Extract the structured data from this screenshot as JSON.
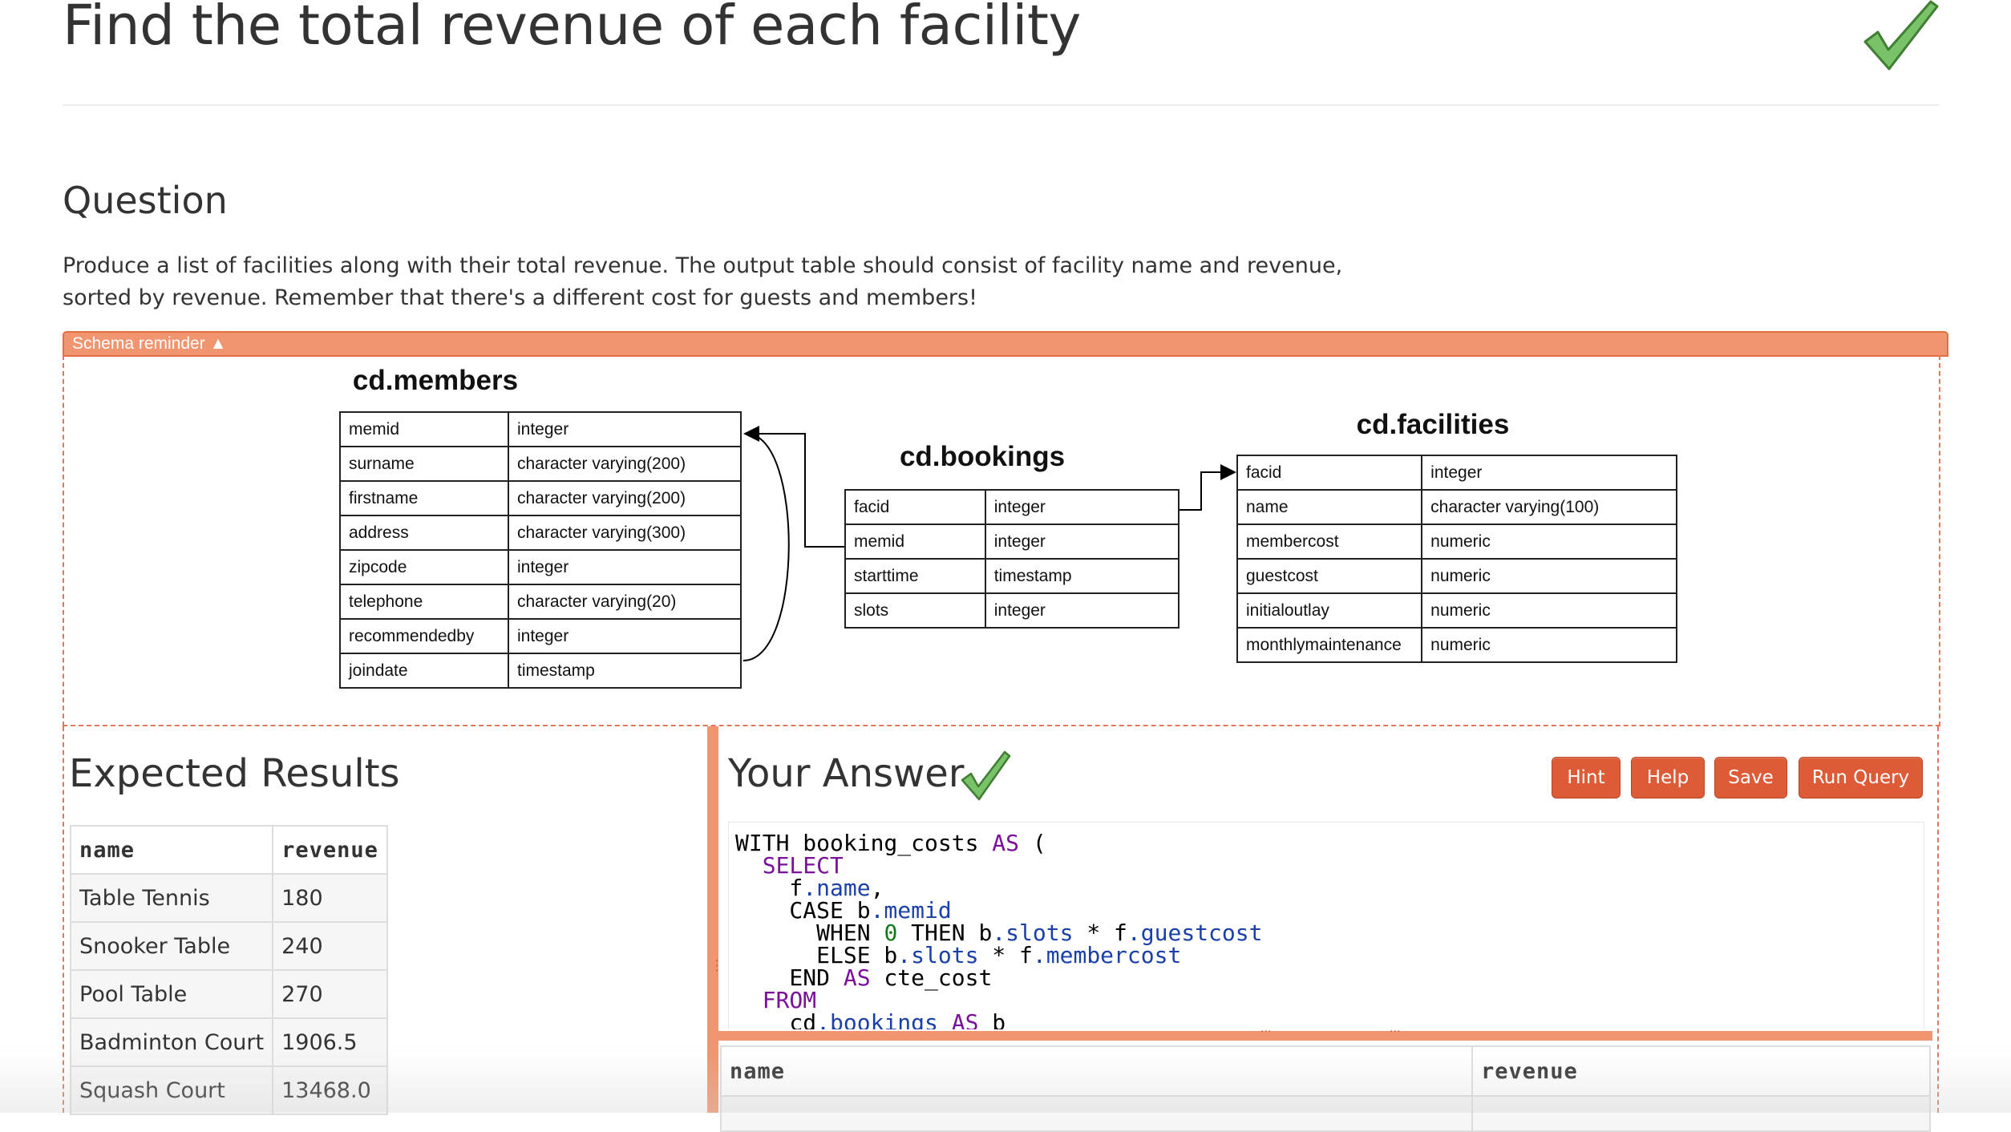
{
  "page": {
    "title": "Find the total revenue of each facility",
    "solved_icon": "checkmark-icon"
  },
  "question": {
    "heading": "Question",
    "text": "Produce a list of facilities along with their total revenue. The output table should consist of facility name and revenue, sorted by revenue. Remember that there's a different cost for guests and members!"
  },
  "schema": {
    "toggle_label": "Schema reminder ▲",
    "tables": {
      "members": {
        "name": "cd.members",
        "columns": [
          [
            "memid",
            "integer"
          ],
          [
            "surname",
            "character varying(200)"
          ],
          [
            "firstname",
            "character varying(200)"
          ],
          [
            "address",
            "character varying(300)"
          ],
          [
            "zipcode",
            "integer"
          ],
          [
            "telephone",
            "character varying(20)"
          ],
          [
            "recommendedby",
            "integer"
          ],
          [
            "joindate",
            "timestamp"
          ]
        ]
      },
      "bookings": {
        "name": "cd.bookings",
        "columns": [
          [
            "facid",
            "integer"
          ],
          [
            "memid",
            "integer"
          ],
          [
            "starttime",
            "timestamp"
          ],
          [
            "slots",
            "integer"
          ]
        ]
      },
      "facilities": {
        "name": "cd.facilities",
        "columns": [
          [
            "facid",
            "integer"
          ],
          [
            "name",
            "character varying(100)"
          ],
          [
            "membercost",
            "numeric"
          ],
          [
            "guestcost",
            "numeric"
          ],
          [
            "initialoutlay",
            "numeric"
          ],
          [
            "monthlymaintenance",
            "numeric"
          ]
        ]
      }
    }
  },
  "expected": {
    "heading": "Expected Results",
    "headers": [
      "name",
      "revenue"
    ],
    "rows": [
      [
        "Table Tennis",
        "180"
      ],
      [
        "Snooker Table",
        "240"
      ],
      [
        "Pool Table",
        "270"
      ],
      [
        "Badminton Court",
        "1906.5"
      ],
      [
        "Squash Court",
        "13468.0"
      ]
    ]
  },
  "answer": {
    "heading": "Your Answer",
    "buttons": {
      "hint": "Hint",
      "help": "Help",
      "save": "Save",
      "run": "Run Query"
    },
    "code_lines": [
      "WITH booking_costs AS (",
      "  SELECT",
      "    f.name,",
      "    CASE b.memid",
      "      WHEN 0 THEN b.slots * f.guestcost",
      "      ELSE b.slots * f.membercost",
      "    END AS cte_cost",
      "  FROM",
      "    cd.bookings AS b"
    ],
    "result_headers": [
      "name",
      "revenue"
    ]
  },
  "colors": {
    "accent": "#de5b37",
    "schema_bar": "#f0956f",
    "check_green": "#6dbb5f"
  }
}
